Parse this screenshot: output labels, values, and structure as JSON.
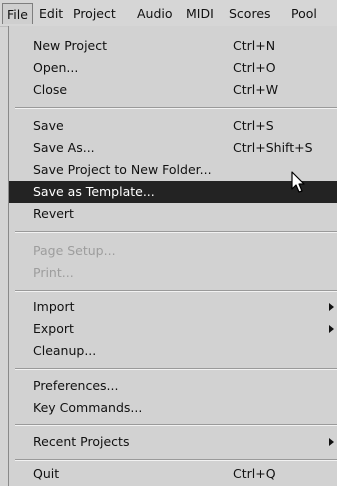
{
  "menubar": {
    "items": [
      {
        "label": "File"
      },
      {
        "label": "Edit"
      },
      {
        "label": "Project"
      },
      {
        "label": "Audio"
      },
      {
        "label": "MIDI"
      },
      {
        "label": "Scores"
      },
      {
        "label": "Pool"
      }
    ]
  },
  "file_menu": {
    "new_project": {
      "label": "New Project",
      "shortcut": "Ctrl+N"
    },
    "open": {
      "label": "Open...",
      "shortcut": "Ctrl+O"
    },
    "close": {
      "label": "Close",
      "shortcut": "Ctrl+W"
    },
    "save": {
      "label": "Save",
      "shortcut": "Ctrl+S"
    },
    "save_as": {
      "label": "Save As...",
      "shortcut": "Ctrl+Shift+S"
    },
    "save_project_new_folder": {
      "label": "Save Project to New Folder..."
    },
    "save_as_template": {
      "label": "Save as Template..."
    },
    "revert": {
      "label": "Revert"
    },
    "page_setup": {
      "label": "Page Setup..."
    },
    "print": {
      "label": "Print..."
    },
    "import": {
      "label": "Import"
    },
    "export": {
      "label": "Export"
    },
    "cleanup": {
      "label": "Cleanup..."
    },
    "preferences": {
      "label": "Preferences..."
    },
    "key_commands": {
      "label": "Key Commands..."
    },
    "recent_projects": {
      "label": "Recent Projects"
    },
    "quit": {
      "label": "Quit",
      "shortcut": "Ctrl+Q"
    }
  },
  "selected_item": "save_as_template",
  "submenu_arrow_icon": "triangle-right-icon",
  "cursor_icon": "mouse-pointer-icon"
}
